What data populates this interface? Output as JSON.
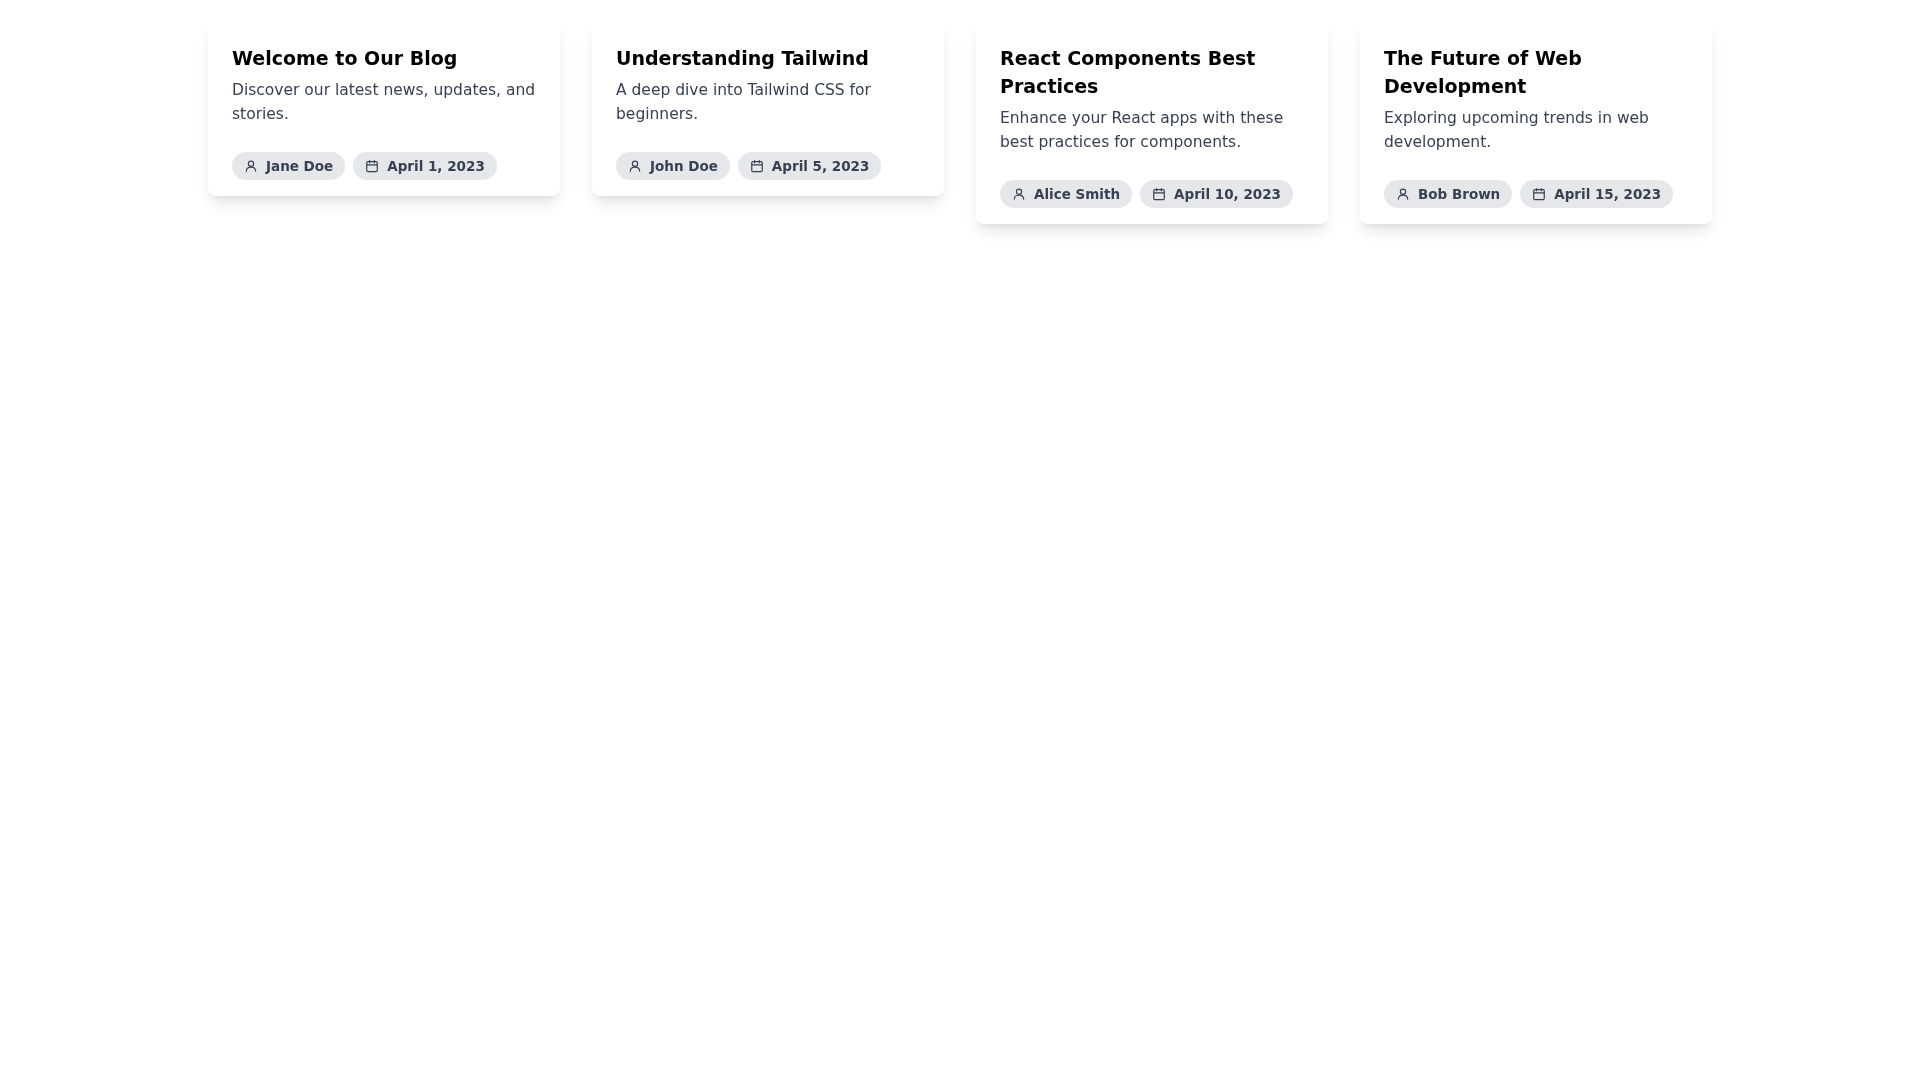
{
  "posts": [
    {
      "title": "Welcome to Our Blog",
      "description": "Discover our latest news, updates, and stories.",
      "author": "Jane Doe",
      "date": "April 1, 2023"
    },
    {
      "title": "Understanding Tailwind",
      "description": "A deep dive into Tailwind CSS for beginners.",
      "author": "John Doe",
      "date": "April 5, 2023"
    },
    {
      "title": "React Components Best Practices",
      "description": "Enhance your React apps with these best practices for components.",
      "author": "Alice Smith",
      "date": "April 10, 2023"
    },
    {
      "title": "The Future of Web Development",
      "description": "Exploring upcoming trends in web development.",
      "author": "Bob Brown",
      "date": "April 15, 2023"
    }
  ]
}
